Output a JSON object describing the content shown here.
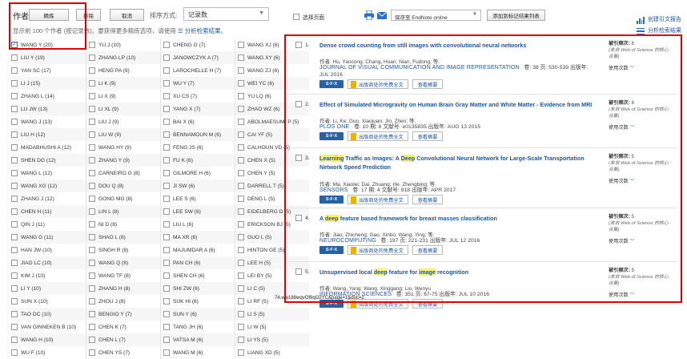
{
  "left": {
    "header": "作者",
    "buttons": {
      "refine": "精炼",
      "exclude": "排除",
      "cancel": "取消"
    },
    "sort_label": "排序方式:",
    "sort_value": "记录数",
    "info_text": "显示前 100 个作者 (按记录数)。要获得更多精炼选项，请使用",
    "info_link": "分析检索结果",
    "info_end": "。",
    "authors": [
      "WANG Y (20)",
      "YU J (10)",
      "CHENG G (7)",
      "WANG XJ (6)",
      "LIU Y (19)",
      "ZHANG LP (10)",
      "JANOWCZYK A (7)",
      "WANG XY (6)",
      "YAN SC (17)",
      "HENG PA (9)",
      "LAROCHELLE H (7)",
      "WANG ZJ (6)",
      "LI J (15)",
      "LI K (9)",
      "WU Y (7)",
      "WEI YC (6)",
      "ZHANG L (14)",
      "LI X (9)",
      "XU CS (7)",
      "YU LQ (6)",
      "LU JW (13)",
      "LI XL (9)",
      "YANG X (7)",
      "ZHAO WZ (6)",
      "WANG J (13)",
      "LIU J (9)",
      "BAI X (6)",
      "ABOLMAESUMI P (5)",
      "LIU H (12)",
      "LIU W (9)",
      "BENNAMOUN M (6)",
      "CAI YF (5)",
      "MADABHUSHI A (12)",
      "WANG HY (9)",
      "FENG JS (6)",
      "CALHOUN VD (5)",
      "SHEN DG (12)",
      "ZHANG Y (9)",
      "FU K (6)",
      "CHEN X (5)",
      "WANG L (12)",
      "CARNEIRO G (8)",
      "GILMORE H (6)",
      "CHEN Y (5)",
      "WANG XG (12)",
      "DOU Q (8)",
      "JI SW (6)",
      "DARRELL T (5)",
      "ZHANG J (12)",
      "GONG MG (8)",
      "LEE S (6)",
      "DENG L (5)",
      "CHEN H (11)",
      "LIN L (8)",
      "LEE SW (6)",
      "EIDELBERG D (5)",
      "QIN J (11)",
      "NI D (8)",
      "LIU L (6)",
      "ERICKSON BJ (5)",
      "WANG G (11)",
      "SHAO L (8)",
      "MA XR (6)",
      "GUO L (5)",
      "HAN JW (10)",
      "SINGH R (8)",
      "MAJUMDAR A (6)",
      "HINTON GE (5)",
      "JIAO LC (10)",
      "WANG Q (8)",
      "PAN CH (6)",
      "LEE H (5)",
      "KIM J (10)",
      "WANG TF (8)",
      "SHEN CH (6)",
      "LEI BY (5)",
      "LI Y (10)",
      "ZHANG H (8)",
      "SHI ZW (6)",
      "LI C (5)",
      "SUN X (10)",
      "ZHOU J (8)",
      "SUK HI (6)",
      "LI RF (5)",
      "TAO DC (10)",
      "BENGIO Y (7)",
      "SUN Y (6)",
      "LI S (5)",
      "VAN GINNEKEN B (10)",
      "CHEN K (7)",
      "TANG JH (6)",
      "LI W (5)",
      "WANG H (10)",
      "CHEN L (7)",
      "VATSA M (6)",
      "LI YS (5)",
      "WU F (10)",
      "CHEN YS (7)",
      "WANG M (6)",
      "LIANG XD (5)"
    ],
    "url_status": "74.ww188wqvOf9qO2YC&page=1&doc=2"
  },
  "toolbar": {
    "select_page": "选择页面",
    "endnote_value": "保存至 EndNote online",
    "mark_list_button": "添加到标记结果列表",
    "citation_report": "创建引文报告",
    "analyze_results": "分析检索结果"
  },
  "records": [
    {
      "num": "1.",
      "title_parts": [
        [
          "Dense crowd counting from still images with convolutional neural networks",
          false
        ]
      ],
      "authors": "作者: Hu, Yaocong; Chang, Huan; Nian, Fudong; 等.",
      "journal": "JOURNAL OF VISUAL COMMUNICATION AND IMAGE REPRESENTATION",
      "journal_meta": "卷: 38  页: 530-539  出版年:",
      "journal_meta2": "JUL 2016",
      "cited_label": "被引频次: ",
      "cited_count": "8",
      "cited_src": "(来自 Web of Science 的核心合集)",
      "usage": "使用次数"
    },
    {
      "num": "2.",
      "title_parts": [
        [
          "Effect of Simulated Microgravity on Human Brain Gray Matter and White Matter - Evidence from MRI",
          false
        ]
      ],
      "authors": "作者: Li, Ke; Guo, Xiaojuan; Jin, Zhen; 等.",
      "journal": "PLOS ONE",
      "journal_meta": "卷: 10  期: 8  文献号: e0135835  出版年: AUG 13 2015",
      "journal_meta2": "",
      "cited_label": "被引频次: ",
      "cited_count": "8",
      "cited_src": "(来自 Web of Science 的核心合集)",
      "usage": "使用次数"
    },
    {
      "num": "3.",
      "title_parts": [
        [
          "Learning",
          true
        ],
        [
          " Traffic as Images: A ",
          false
        ],
        [
          "Deep",
          true
        ],
        [
          " Convolutional Neural Network for Large-Scale Transportation Network Speed Prediction",
          false
        ]
      ],
      "authors": "作者: Ma, Xiaolei; Dai, Zhuang; He, Zhengbing; 等.",
      "journal": "SENSORS",
      "journal_meta": "卷: 17  期: 4  文献号: 818  出版年: APR 2017",
      "journal_meta2": "",
      "cited_label": "被引频次: ",
      "cited_count": "5",
      "cited_src": "(来自 Web of Science 的核心合集)",
      "usage": "使用次数"
    },
    {
      "num": "4.",
      "title_parts": [
        [
          "A ",
          false
        ],
        [
          "deep",
          true
        ],
        [
          " feature based framework for breast masses classification",
          false
        ]
      ],
      "authors": "作者: Jiao, Zhicheng; Gao, Xinbo; Wang, Ying; 等.",
      "journal": "NEUROCOMPUTING",
      "journal_meta": "卷: 197  页: 221-231  出版年: JUL 12 2016",
      "journal_meta2": "",
      "cited_label": "被引频次: ",
      "cited_count": "5",
      "cited_src": "(来自 Web of Science 的核心合集)",
      "usage": "使用次数"
    },
    {
      "num": "5.",
      "title_parts": [
        [
          "Unsupervised local ",
          false
        ],
        [
          "deep",
          true
        ],
        [
          " feature for ",
          false
        ],
        [
          "image",
          true
        ],
        [
          " recognition",
          false
        ]
      ],
      "authors": "作者: Wang, Yang; Wang, Xinggang; Liu, Wenyu",
      "journal": "INFORMATION SCIENCES",
      "journal_meta": "卷: 351  页: 67-75  出版年: JUL 10 2016",
      "journal_meta2": "",
      "cited_label": "被引频次: ",
      "cited_count": "5",
      "cited_src": "(来自 Web of Science 的核心合集)",
      "usage": "使用次数"
    }
  ],
  "actions": {
    "sfx": "S·F·X",
    "fulltext": "出版商处的免费全文",
    "abstract": "查看摘要"
  },
  "colors": {
    "link": "#1a56a8",
    "highlight": "#fff36b",
    "annotation_red": "#e00000",
    "sfx_blue": "#2563a6"
  }
}
